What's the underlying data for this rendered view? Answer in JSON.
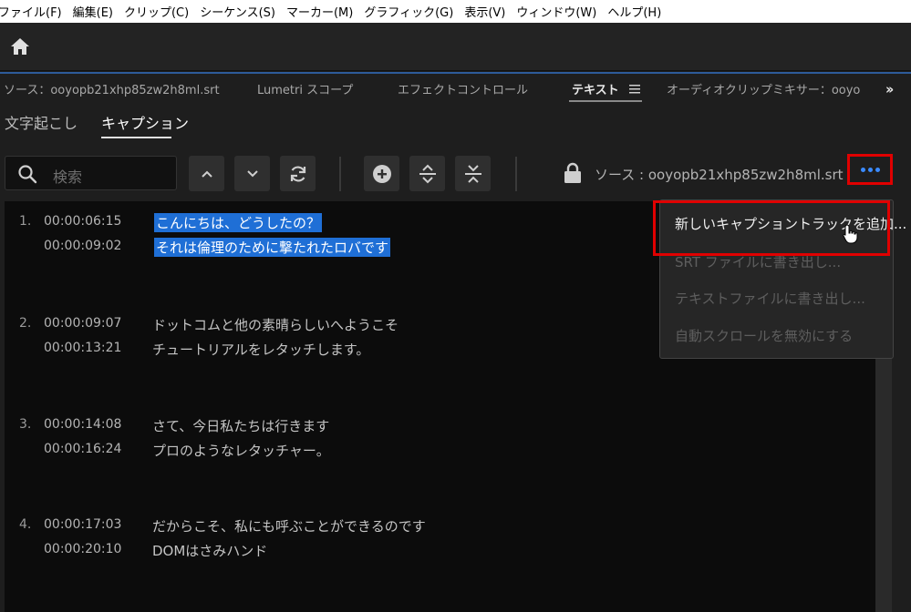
{
  "menubar": {
    "items": [
      "ファイル(F)",
      "編集(E)",
      "クリップ(C)",
      "シーケンス(S)",
      "マーカー(M)",
      "グラフィック(G)",
      "表示(V)",
      "ウィンドウ(W)",
      "ヘルプ(H)"
    ]
  },
  "panel_tabs": {
    "source": "ソース：ooyopb21xhp85zw2h8ml.srt",
    "lumetri": "Lumetri スコープ",
    "effect_controls": "エフェクトコントロール",
    "text": "テキスト",
    "audio_mixer": "オーディオクリップミキサー：ooyo"
  },
  "subtabs": {
    "transcription": "文字起こし",
    "captions": "キャプション"
  },
  "search": {
    "placeholder": "検索"
  },
  "source_label": "ソース : ooyopb21xhp85zw2h8ml.srt",
  "captions": [
    {
      "num": "1.",
      "in": "00:00:06:15",
      "out": "00:00:09:02",
      "line1": "こんにちは、どうしたの？",
      "line2": "それは倫理のために撃たれたロバです"
    },
    {
      "num": "2.",
      "in": "00:00:09:07",
      "out": "00:00:13:21",
      "line1": "ドットコムと他の素晴らしいへようこそ",
      "line2": "チュートリアルをレタッチします。"
    },
    {
      "num": "3.",
      "in": "00:00:14:08",
      "out": "00:00:16:24",
      "line1": "さて、今日私たちは行きます",
      "line2": "プロのようなレタッチャー。"
    },
    {
      "num": "4.",
      "in": "00:00:17:03",
      "out": "00:00:20:10",
      "line1": "だからこそ、私にも呼ぶことができるのです",
      "line2": "DOMはさみハンド"
    }
  ],
  "dropdown": {
    "add_caption_track": "新しいキャプショントラックを追加...",
    "export_srt": "SRT ファイルに書き出し...",
    "export_text": "テキストファイルに書き出し...",
    "disable_autoscroll": "自動スクロールを無効にする"
  },
  "colors": {
    "accent": "#3b8bff",
    "selection": "#1f6fd6",
    "highlight_box": "#e00000"
  }
}
